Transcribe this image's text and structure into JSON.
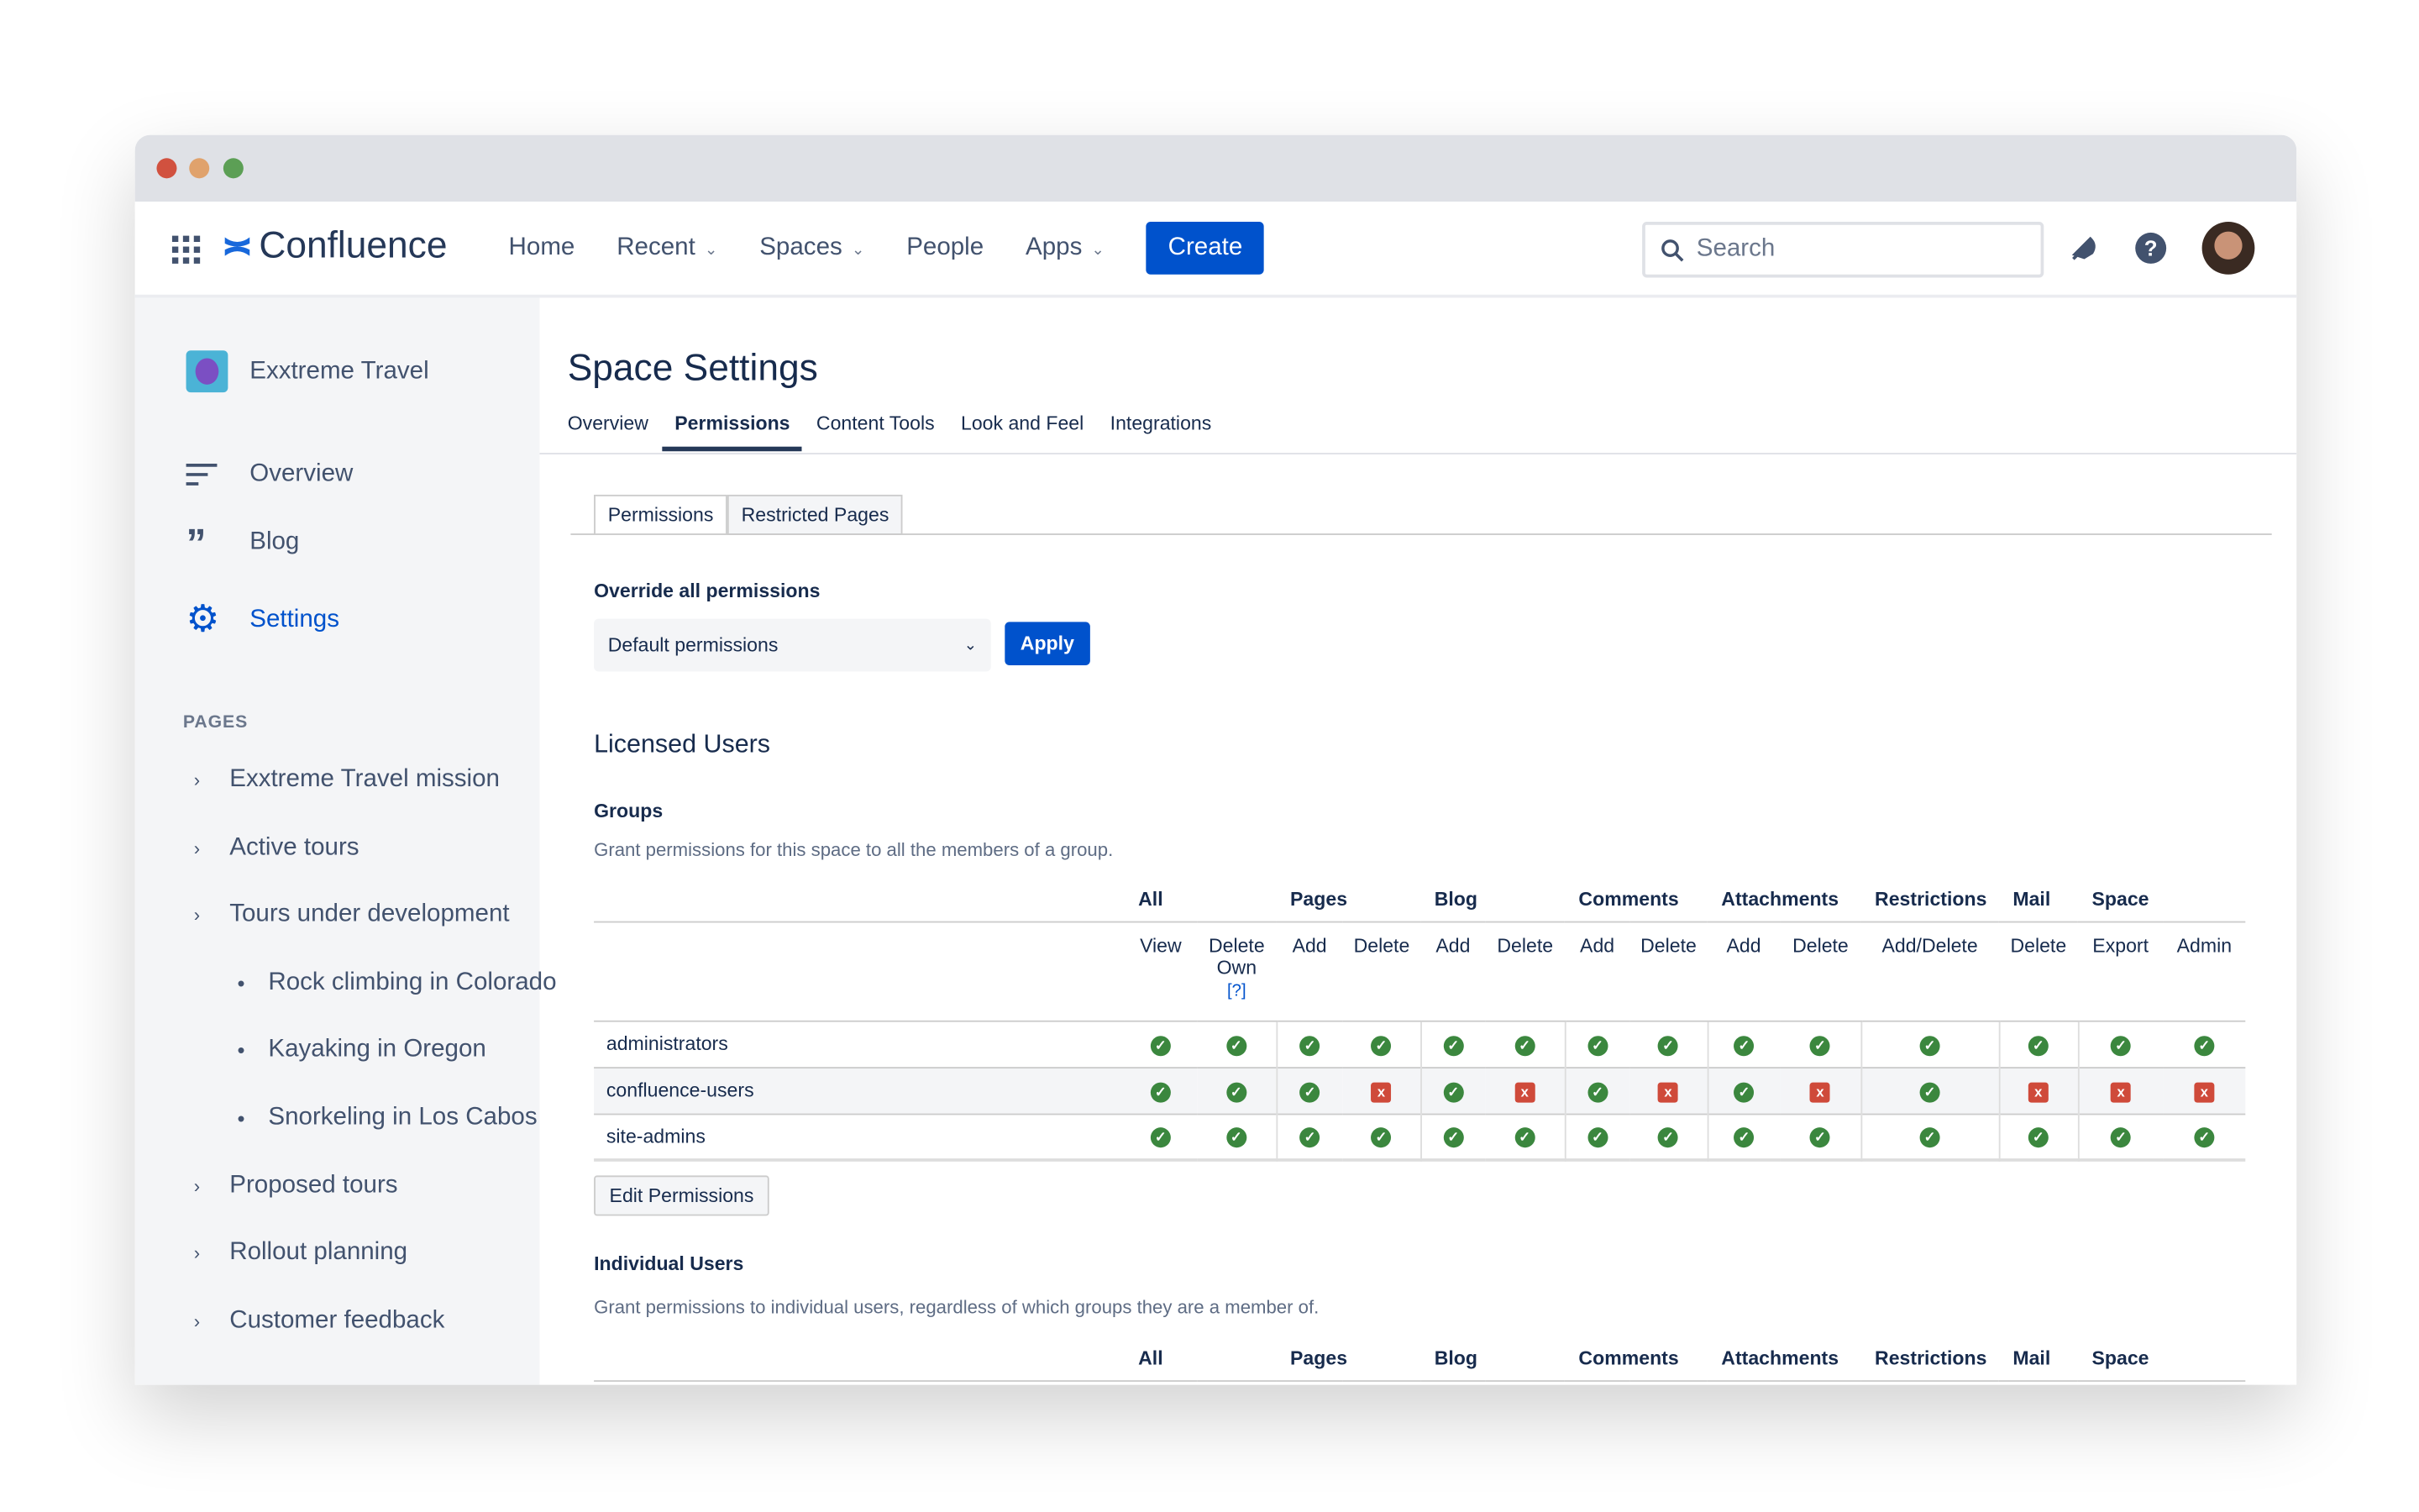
{
  "colors": {
    "accent": "#0052cc",
    "ok": "#3b873e",
    "deny": "#cf4a3a",
    "sidebar_bg": "#f4f5f7"
  },
  "nav": {
    "app_name": "Confluence",
    "items": [
      {
        "label": "Home"
      },
      {
        "label": "Recent",
        "dropdown": true
      },
      {
        "label": "Spaces",
        "dropdown": true
      },
      {
        "label": "People"
      },
      {
        "label": "Apps",
        "dropdown": true
      }
    ],
    "create_label": "Create",
    "search_placeholder": "Search"
  },
  "sidebar": {
    "space_name": "Exxtreme Travel",
    "items": [
      {
        "label": "Overview",
        "icon": "lines-icon"
      },
      {
        "label": "Blog",
        "icon": "quote-icon"
      },
      {
        "label": "Settings",
        "icon": "gear-icon",
        "active": true
      }
    ],
    "pages_heading": "PAGES",
    "pages": [
      {
        "label": "Exxtreme Travel mission",
        "type": "chevron"
      },
      {
        "label": "Active tours",
        "type": "chevron"
      },
      {
        "label": "Tours under development",
        "type": "chevron"
      },
      {
        "label": "Rock climbing in Colorado",
        "type": "bullet"
      },
      {
        "label": "Kayaking in Oregon",
        "type": "bullet"
      },
      {
        "label": "Snorkeling in Los Cabos",
        "type": "bullet"
      },
      {
        "label": "Proposed tours",
        "type": "chevron"
      },
      {
        "label": "Rollout planning",
        "type": "chevron"
      },
      {
        "label": "Customer feedback",
        "type": "chevron"
      }
    ]
  },
  "main": {
    "title": "Space Settings",
    "tabs": [
      {
        "label": "Overview"
      },
      {
        "label": "Permissions",
        "active": true
      },
      {
        "label": "Content Tools"
      },
      {
        "label": "Look and Feel"
      },
      {
        "label": "Integrations"
      }
    ],
    "subtabs": [
      {
        "label": "Permissions",
        "active": true
      },
      {
        "label": "Restricted Pages"
      }
    ],
    "override_label": "Override all permissions",
    "override_value": "Default permissions",
    "apply_label": "Apply",
    "licensed_heading": "Licensed Users",
    "groups_heading": "Groups",
    "groups_desc": "Grant permissions for this space to all the members of a group.",
    "group_headers": [
      "All",
      "Pages",
      "Blog",
      "Comments",
      "Attachments",
      "Restrictions",
      "Mail",
      "Space"
    ],
    "sub_headers": [
      "View",
      "Delete Own",
      "Add",
      "Delete",
      "Add",
      "Delete",
      "Add",
      "Delete",
      "Add",
      "Delete",
      "Add/Delete",
      "Delete",
      "Export",
      "Admin"
    ],
    "help_link": "[?]",
    "rows": [
      {
        "name": "administrators",
        "perms": [
          1,
          1,
          1,
          1,
          1,
          1,
          1,
          1,
          1,
          1,
          1,
          1,
          1,
          1
        ]
      },
      {
        "name": "confluence-users",
        "perms": [
          1,
          1,
          1,
          0,
          1,
          0,
          1,
          0,
          1,
          0,
          1,
          0,
          0,
          0
        ]
      },
      {
        "name": "site-admins",
        "perms": [
          1,
          1,
          1,
          1,
          1,
          1,
          1,
          1,
          1,
          1,
          1,
          1,
          1,
          1
        ]
      }
    ],
    "edit_label": "Edit Permissions",
    "individual_heading": "Individual Users",
    "individual_desc": "Grant permissions to individual users, regardless of which groups they are a member of."
  }
}
